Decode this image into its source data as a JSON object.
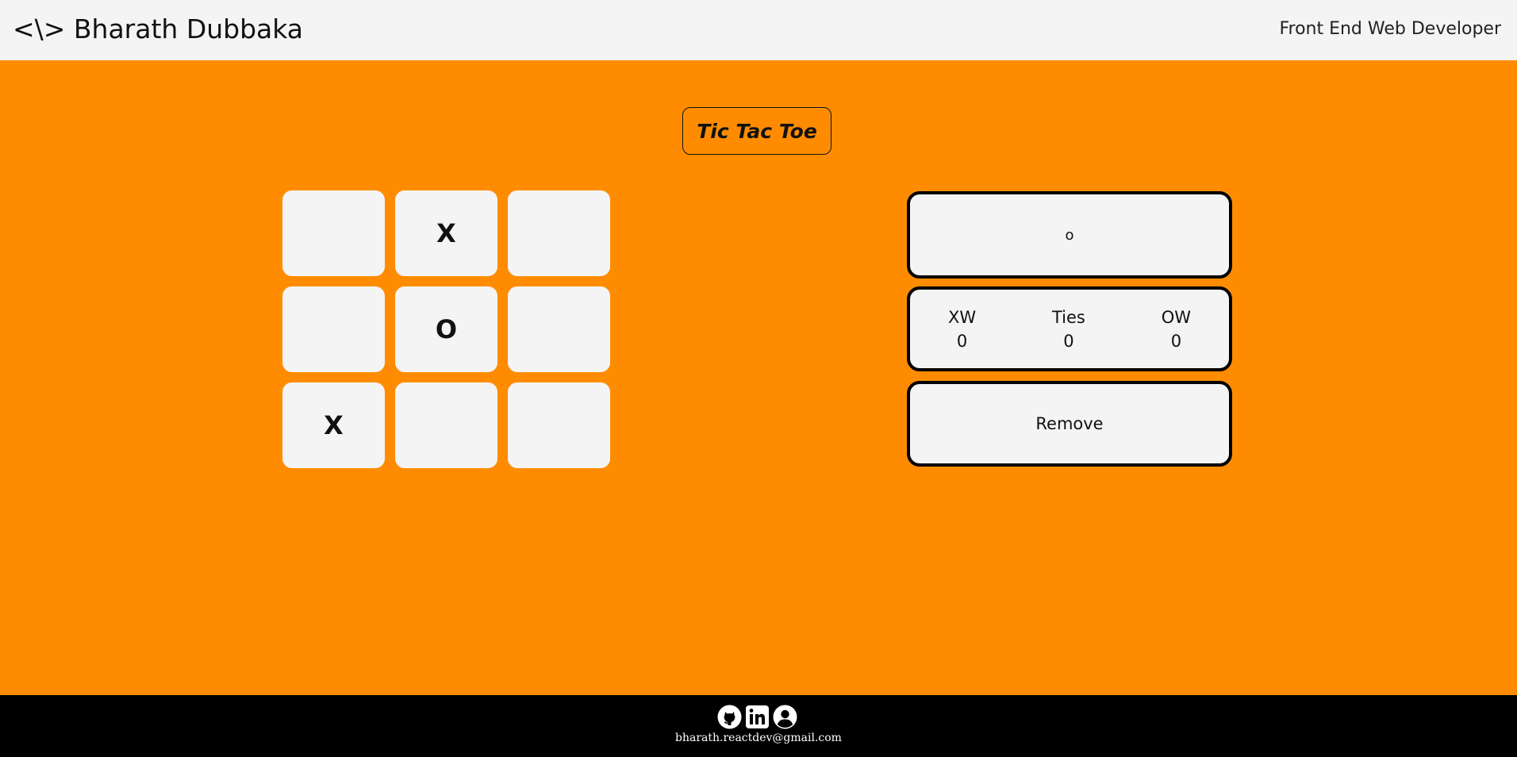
{
  "header": {
    "brand": "<\\> Bharath Dubbaka",
    "role": "Front End Web Developer"
  },
  "game": {
    "title": "Tic Tac Toe",
    "board": [
      "",
      "X",
      "",
      "",
      "O",
      "",
      "X",
      "",
      ""
    ],
    "turn": "o"
  },
  "scoreboard": {
    "x_label": "XW",
    "x_value": "0",
    "ties_label": "Ties",
    "ties_value": "0",
    "o_label": "OW",
    "o_value": "0"
  },
  "reset_label": "Remove",
  "footer": {
    "icons": [
      "github-icon",
      "linkedin-icon",
      "profile-icon"
    ],
    "email": "bharath.reactdev@gmail.com"
  },
  "colors": {
    "background": "#ff8c00",
    "header": "#f4f4f4",
    "cell": "#f4f4f4",
    "footer": "#000000"
  }
}
